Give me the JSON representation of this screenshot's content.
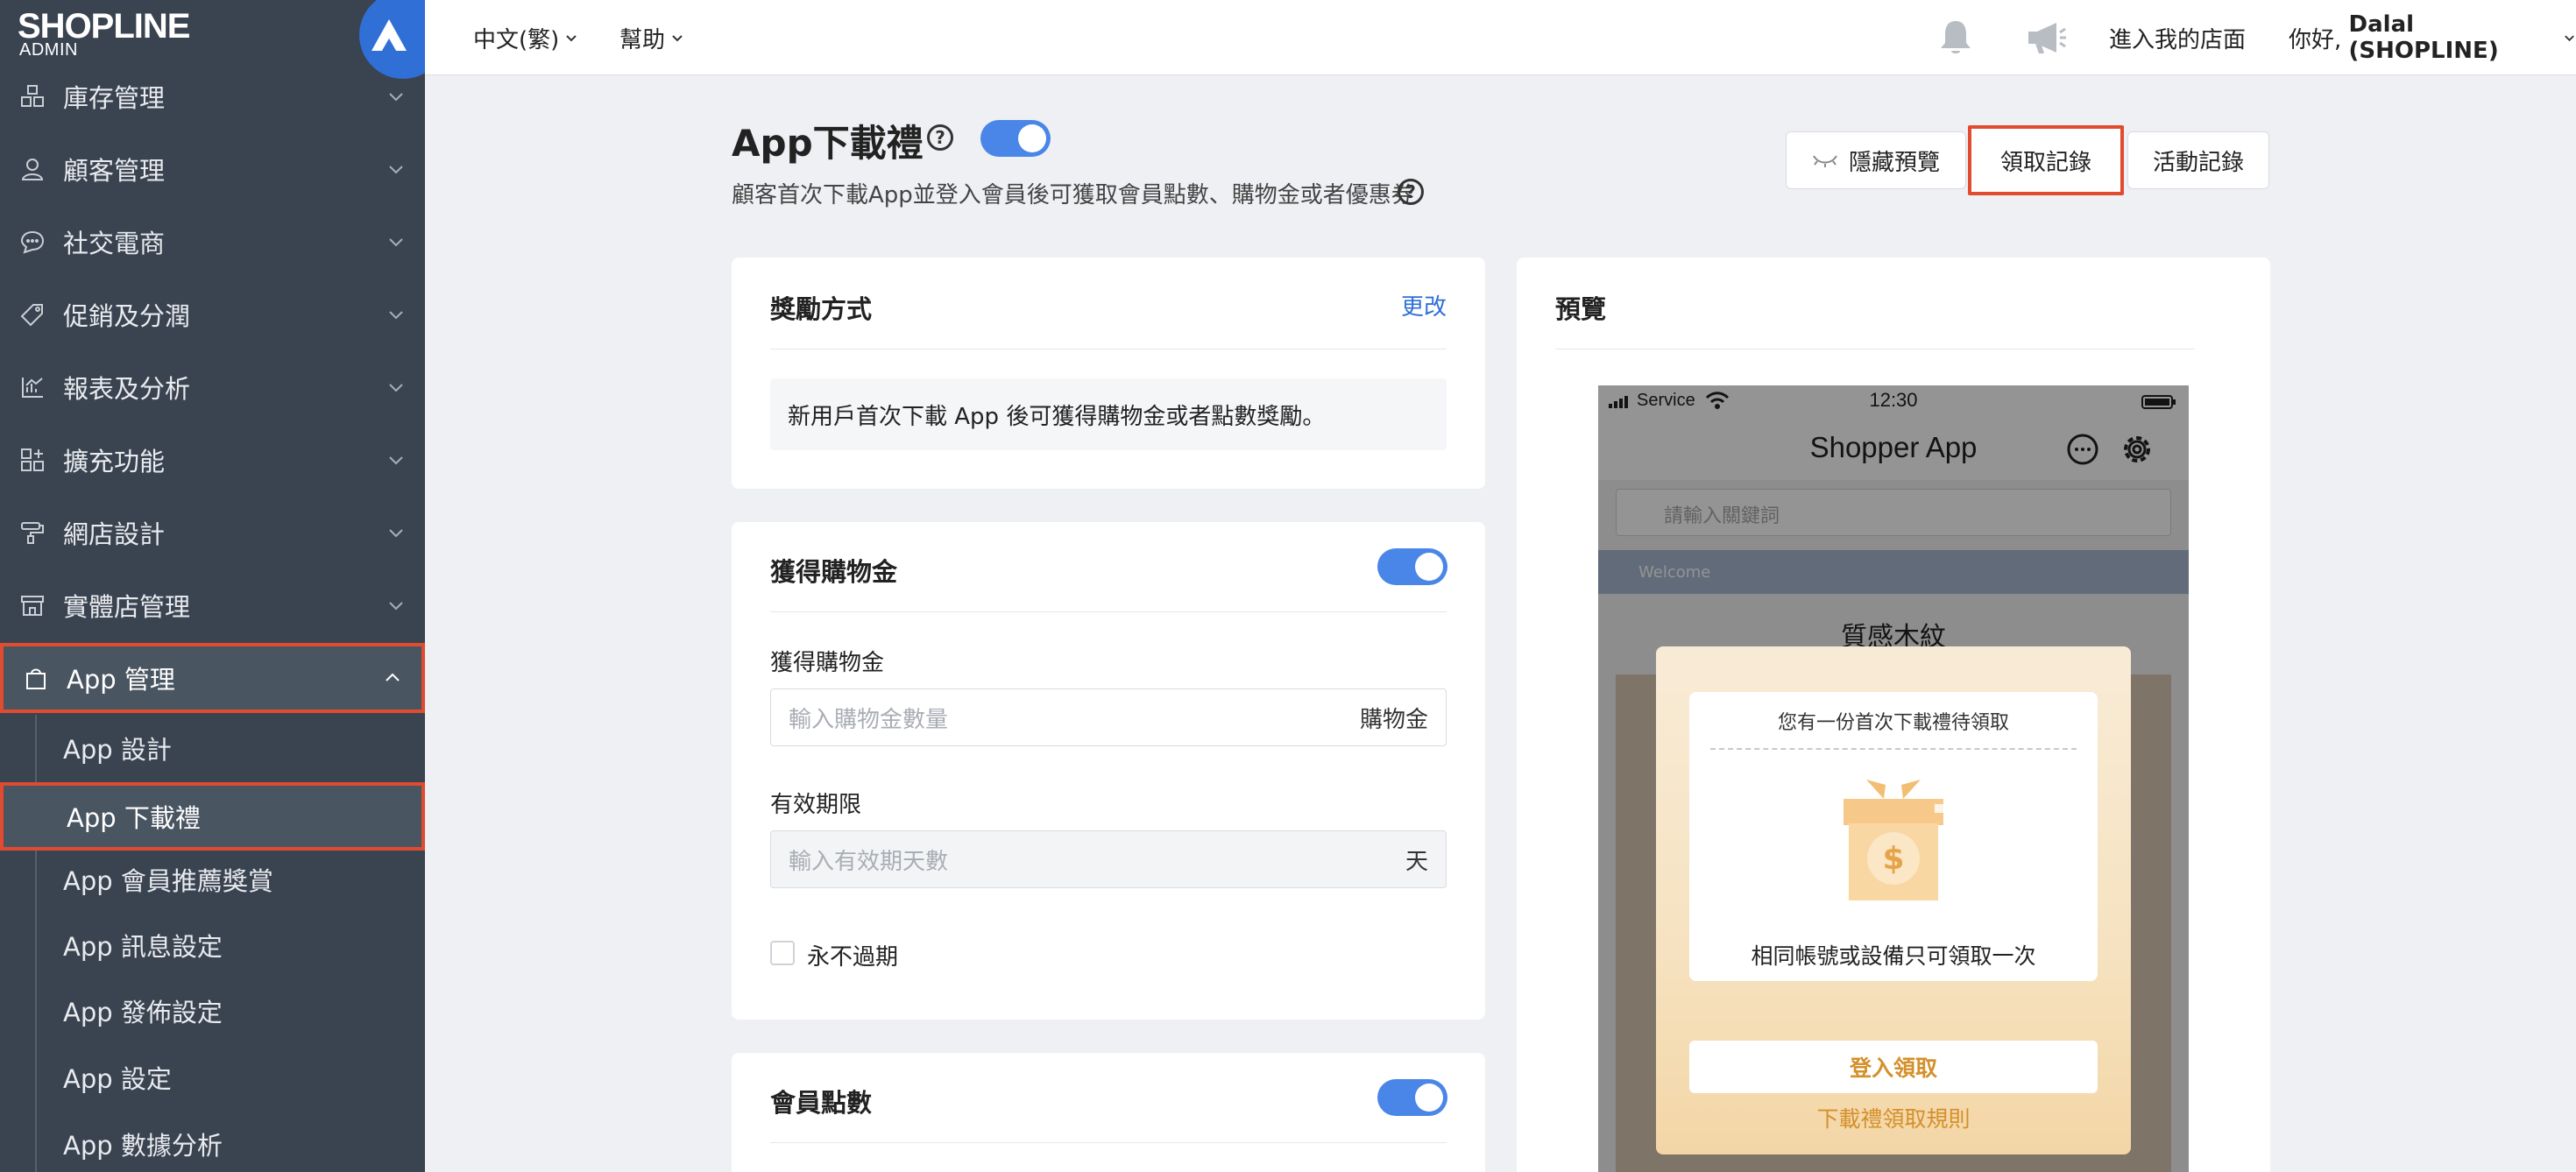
{
  "brand": {
    "logo": "SHOPLINE",
    "sub": "ADMIN"
  },
  "sidebar": {
    "items": [
      {
        "label": "庫存管理",
        "icon": "inventory-icon"
      },
      {
        "label": "顧客管理",
        "icon": "customer-icon"
      },
      {
        "label": "社交電商",
        "icon": "chat-icon"
      },
      {
        "label": "促銷及分潤",
        "icon": "tag-icon"
      },
      {
        "label": "報表及分析",
        "icon": "report-icon"
      },
      {
        "label": "擴充功能",
        "icon": "apps-icon"
      },
      {
        "label": "網店設計",
        "icon": "paint-roller-icon"
      },
      {
        "label": "實體店管理",
        "icon": "store-icon"
      },
      {
        "label": "App 管理",
        "icon": "shopping-bag-icon"
      }
    ],
    "subitems": [
      {
        "label": "App 設計"
      },
      {
        "label": "App 下載禮"
      },
      {
        "label": "App 會員推薦獎賞"
      },
      {
        "label": "App 訊息設定"
      },
      {
        "label": "App 發佈設定"
      },
      {
        "label": "App 設定"
      },
      {
        "label": "App 數據分析"
      }
    ]
  },
  "topbar": {
    "language": "中文(繁)",
    "help": "幫助",
    "storefront": "進入我的店面",
    "greeting_prefix": "你好, ",
    "user": "Dalal (SHOPLINE)"
  },
  "page": {
    "title": "App下載禮",
    "enabled": true,
    "description": "顧客首次下載App並登入會員後可獲取會員點數、購物金或者優惠券",
    "buttons": {
      "hide_preview": "隱藏預覽",
      "claim_records": "領取記錄",
      "activity_records": "活動記錄"
    }
  },
  "reward_card": {
    "title": "獎勵方式",
    "edit": "更改",
    "note": "新用戶首次下載 App 後可獲得購物金或者點數獎勵。"
  },
  "credit_card": {
    "title": "獲得購物金",
    "enabled": true,
    "amount_label": "獲得購物金",
    "amount_placeholder": "輸入購物金數量",
    "amount_suffix": "購物金",
    "validity_label": "有效期限",
    "validity_placeholder": "輸入有效期天數",
    "validity_suffix": "天",
    "never_expire": "永不過期",
    "never_expire_checked": false
  },
  "points_card": {
    "title": "會員點數",
    "enabled": true
  },
  "preview": {
    "title": "預覽",
    "status_carrier": "Service",
    "status_time": "12:30",
    "app_name": "Shopper App",
    "search_placeholder": "請輸入關鍵詞",
    "welcome": "Welcome",
    "body_title": "質感木紋",
    "popup_head": "您有一份首次下載禮待領取",
    "popup_msg": "相同帳號或設備只可領取一次",
    "popup_button": "登入領取",
    "popup_link": "下載禮領取規則"
  },
  "colors": {
    "accent": "#4a86e8",
    "highlight": "#e14b2f",
    "sidebar": "#3a4350",
    "gold": "#d4902a"
  }
}
